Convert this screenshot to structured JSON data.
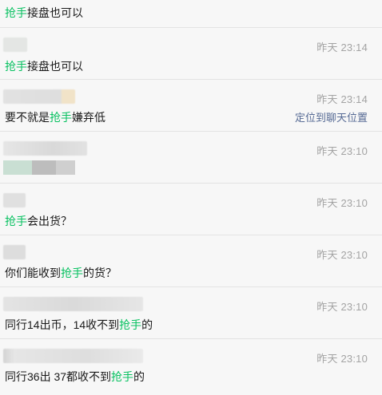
{
  "keyword": "抢手",
  "colors": {
    "keyword": "#07c160",
    "time": "#a3a3a3",
    "link": "#576b95",
    "divider": "#e3e3e3",
    "background": "#f7f7f7"
  },
  "results": [
    {
      "time": "",
      "pre": "",
      "kw": "抢手",
      "post": "接盘也可以",
      "locate": ""
    },
    {
      "time": "昨天 23:14",
      "pre": "",
      "kw": "抢手",
      "post": "接盘也可以",
      "locate": ""
    },
    {
      "time": "昨天 23:14",
      "pre": "要不就是",
      "kw": "抢手",
      "post": "嫌弃低",
      "locate": "定位到聊天位置"
    },
    {
      "time": "昨天 23:10",
      "pre": "",
      "kw": "",
      "post": "",
      "locate": ""
    },
    {
      "time": "昨天 23:10",
      "pre": "",
      "kw": "抢手",
      "post": "会出货？",
      "locate": ""
    },
    {
      "time": "昨天 23:10",
      "pre": "你们能收到",
      "kw": "抢手",
      "post": "的货？",
      "locate": ""
    },
    {
      "time": "昨天 23:10",
      "pre": "同行14出币，14收不到",
      "kw": "抢手",
      "post": "的",
      "locate": ""
    },
    {
      "time": "昨天 23:10",
      "pre": "同行36出 37都收不到",
      "kw": "抢手",
      "post": "的",
      "locate": ""
    }
  ]
}
